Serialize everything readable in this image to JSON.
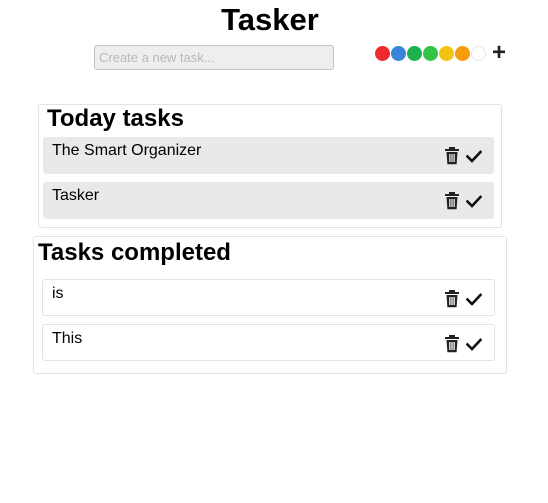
{
  "app": {
    "title": "Tasker"
  },
  "new_task": {
    "placeholder": "Create a new task...",
    "value": ""
  },
  "color_options": [
    {
      "name": "red",
      "color": "#ee2a2e"
    },
    {
      "name": "blue",
      "color": "#3b84d9"
    },
    {
      "name": "green",
      "color": "#1bb24f"
    },
    {
      "name": "lime",
      "color": "#33c346"
    },
    {
      "name": "yellow",
      "color": "#f2c313"
    },
    {
      "name": "orange",
      "color": "#f59b0d"
    },
    {
      "name": "white",
      "color": "#ffffff"
    }
  ],
  "add_button": {
    "label": "+"
  },
  "today": {
    "heading": "Today tasks",
    "tasks": [
      {
        "text": "The Smart Organizer"
      },
      {
        "text": "Tasker"
      }
    ]
  },
  "completed": {
    "heading": "Tasks completed",
    "tasks": [
      {
        "text": "is"
      },
      {
        "text": "This"
      }
    ]
  },
  "icons": {
    "delete": "trash-icon",
    "complete": "check-icon"
  }
}
